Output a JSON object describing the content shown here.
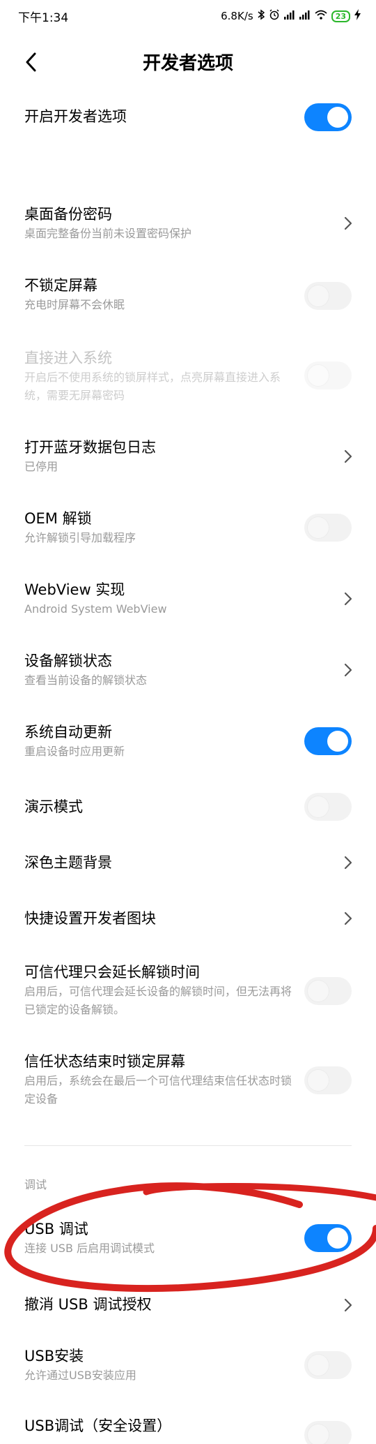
{
  "status_bar": {
    "time": "下午1:34",
    "speed": "6.8K/s",
    "battery": "23",
    "icons": [
      "bluetooth-icon",
      "alarm-icon",
      "signal-icon",
      "signal-icon",
      "wifi-icon",
      "charging-icon"
    ]
  },
  "header": {
    "title": "开发者选项",
    "back_icon": "chevron-left-icon"
  },
  "colors": {
    "accent": "#0d84ff",
    "annotation": "#d8231f"
  },
  "rows": [
    {
      "title": "开启开发者选项",
      "subtitle": "",
      "control": "toggle",
      "state": "on"
    },
    {
      "title": "桌面备份密码",
      "subtitle": "桌面完整备份当前未设置密码保护",
      "control": "chevron"
    },
    {
      "title": "不锁定屏幕",
      "subtitle": "充电时屏幕不会休眠",
      "control": "toggle",
      "state": "off"
    },
    {
      "title": "直接进入系统",
      "subtitle": "开启后不使用系统的锁屏样式，点亮屏幕直接进入系统，需要无屏幕密码",
      "control": "toggle",
      "state": "disabled"
    },
    {
      "title": "打开蓝牙数据包日志",
      "subtitle": "已停用",
      "control": "chevron"
    },
    {
      "title": "OEM 解锁",
      "subtitle": "允许解锁引导加载程序",
      "control": "toggle",
      "state": "off"
    },
    {
      "title": "WebView 实现",
      "subtitle": "Android System WebView",
      "control": "chevron"
    },
    {
      "title": "设备解锁状态",
      "subtitle": "查看当前设备的解锁状态",
      "control": "chevron"
    },
    {
      "title": "系统自动更新",
      "subtitle": "重启设备时应用更新",
      "control": "toggle",
      "state": "on"
    },
    {
      "title": "演示模式",
      "subtitle": "",
      "control": "toggle",
      "state": "off"
    },
    {
      "title": "深色主题背景",
      "subtitle": "",
      "control": "chevron"
    },
    {
      "title": "快捷设置开发者图块",
      "subtitle": "",
      "control": "chevron"
    },
    {
      "title": "可信代理只会延长解锁时间",
      "subtitle": "启用后，可信代理会延长设备的解锁时间，但无法再将已锁定的设备解锁。",
      "control": "toggle",
      "state": "off"
    },
    {
      "title": "信任状态结束时锁定屏幕",
      "subtitle": "启用后，系统会在最后一个可信代理结束信任状态时锁定设备",
      "control": "toggle",
      "state": "off"
    },
    {
      "title": "USB 调试",
      "subtitle": "连接 USB 后启用调试模式",
      "control": "toggle",
      "state": "on"
    },
    {
      "title": "撤消 USB 调试授权",
      "subtitle": "",
      "control": "chevron"
    },
    {
      "title": "USB安装",
      "subtitle": "允许通过USB安装应用",
      "control": "toggle",
      "state": "off"
    },
    {
      "title": "USB调试（安全设置）",
      "subtitle": "",
      "control": "toggle",
      "state": "off"
    }
  ],
  "section": {
    "debug_label": "调试"
  }
}
